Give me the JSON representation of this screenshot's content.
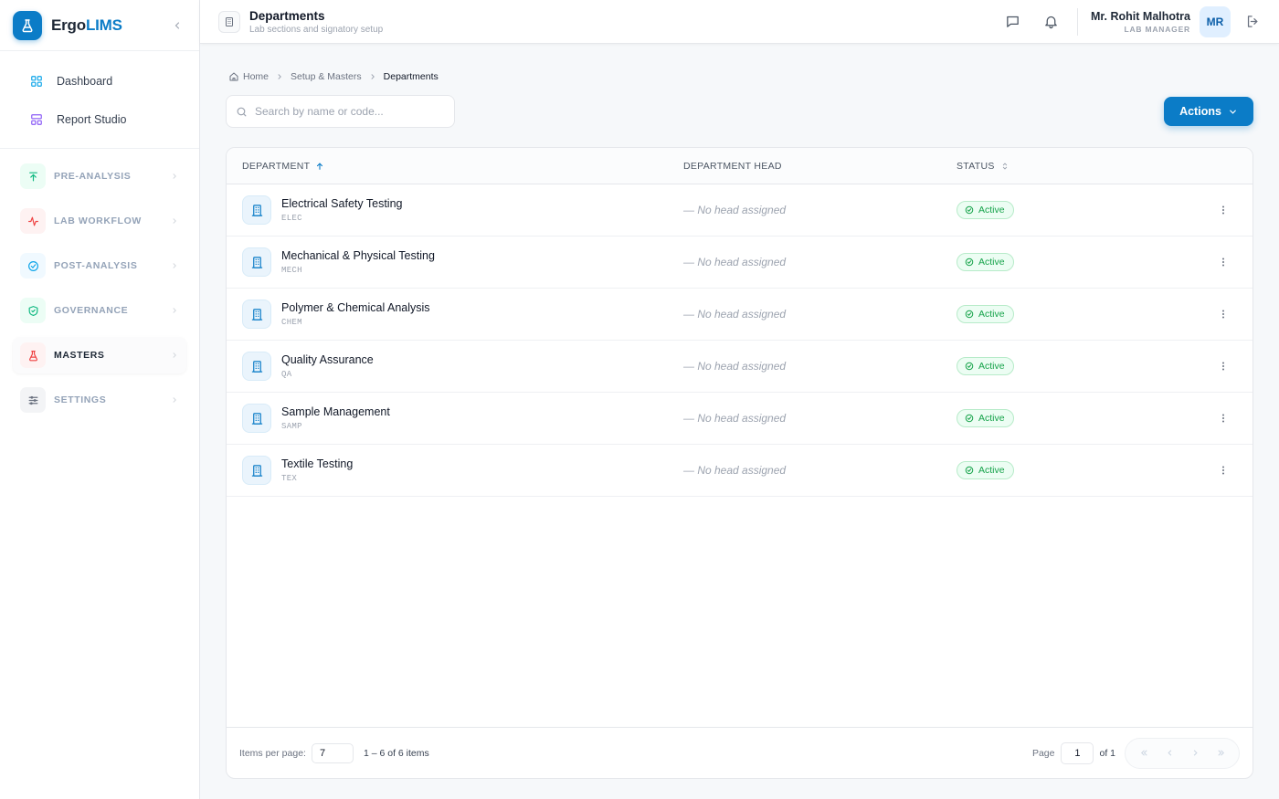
{
  "brand": {
    "name_main": "Ergo",
    "name_accent": "LIMS"
  },
  "sidebar": {
    "top_links": [
      {
        "label": "Dashboard",
        "icon": "grid-icon"
      },
      {
        "label": "Report Studio",
        "icon": "layout-icon"
      }
    ],
    "groups": [
      {
        "label": "PRE-ANALYSIS",
        "icon": "arrow-up-icon",
        "color": "#10b981",
        "bg": "#ecfdf5"
      },
      {
        "label": "LAB WORKFLOW",
        "icon": "activity-icon",
        "color": "#ef4444",
        "bg": "#fef2f2"
      },
      {
        "label": "POST-ANALYSIS",
        "icon": "check-circle-icon",
        "color": "#0ea5e9",
        "bg": "#f0f9ff"
      },
      {
        "label": "GOVERNANCE",
        "icon": "shield-check-icon",
        "color": "#10b981",
        "bg": "#ecfdf5"
      },
      {
        "label": "MASTERS",
        "icon": "flask-icon",
        "color": "#ef4444",
        "bg": "#fef2f2",
        "active": true
      },
      {
        "label": "SETTINGS",
        "icon": "sliders-icon",
        "color": "#6b7280",
        "bg": "#f3f4f6"
      }
    ]
  },
  "header": {
    "title": "Departments",
    "subtitle": "Lab sections and signatory setup",
    "user_name": "Mr. Rohit Malhotra",
    "user_role": "LAB MANAGER",
    "avatar_initials": "MR"
  },
  "breadcrumb": {
    "home": "Home",
    "parent": "Setup & Masters",
    "current": "Departments"
  },
  "search": {
    "placeholder": "Search by name or code..."
  },
  "actions_label": "Actions",
  "table": {
    "columns": {
      "department": "DEPARTMENT",
      "head": "DEPARTMENT HEAD",
      "status": "STATUS"
    },
    "rows": [
      {
        "name": "Electrical Safety Testing",
        "code": "ELEC",
        "head": "— No head assigned",
        "status": "Active"
      },
      {
        "name": "Mechanical & Physical Testing",
        "code": "MECH",
        "head": "— No head assigned",
        "status": "Active"
      },
      {
        "name": "Polymer & Chemical Analysis",
        "code": "CHEM",
        "head": "— No head assigned",
        "status": "Active"
      },
      {
        "name": "Quality Assurance",
        "code": "QA",
        "head": "— No head assigned",
        "status": "Active"
      },
      {
        "name": "Sample Management",
        "code": "SAMP",
        "head": "— No head assigned",
        "status": "Active"
      },
      {
        "name": "Textile Testing",
        "code": "TEX",
        "head": "— No head assigned",
        "status": "Active"
      }
    ]
  },
  "footer": {
    "items_per_page_label": "Items per page:",
    "items_per_page": "7",
    "range": "1 – 6 of 6 items",
    "page_label": "Page",
    "page": "1",
    "of_label": "of 1"
  },
  "colors": {
    "accent": "#0b7cc7",
    "active_green": "#16a34a"
  }
}
